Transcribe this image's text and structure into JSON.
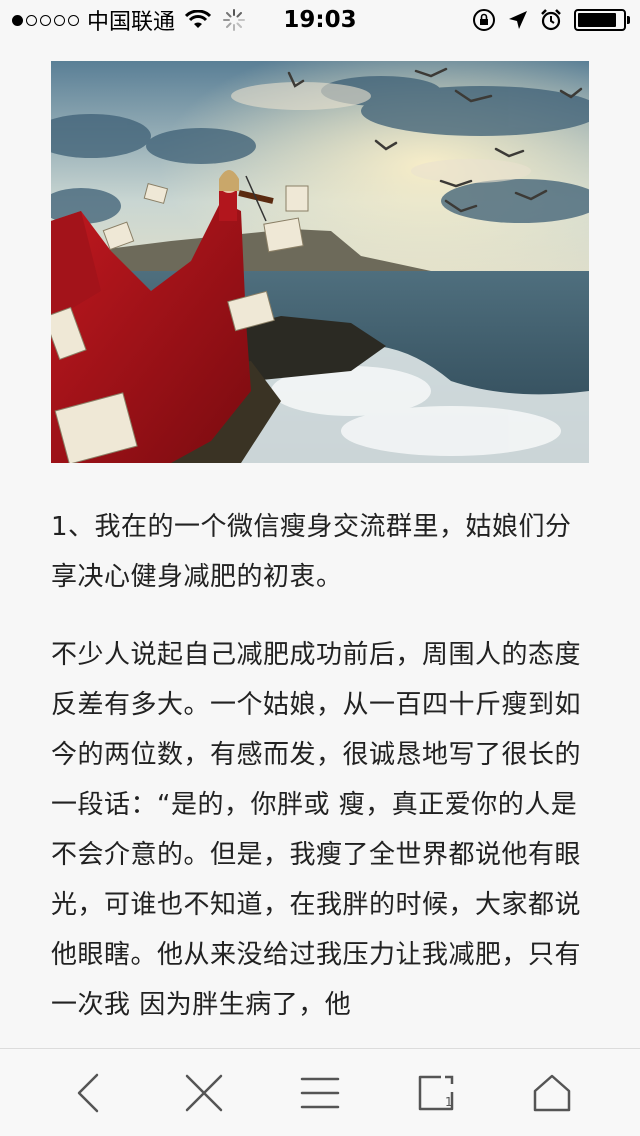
{
  "status_bar": {
    "signal_dots": [
      true,
      false,
      false,
      false,
      false
    ],
    "carrier": "中国联通",
    "time": "19:03",
    "icons": [
      "wifi-icon",
      "loading-spinner-icon",
      "orientation-lock-icon",
      "location-arrow-icon",
      "alarm-icon",
      "battery-icon"
    ],
    "battery_level": 0.85
  },
  "hero_image": {
    "description_icon": "violinist-red-dress-sea-photo"
  },
  "article": {
    "paragraphs": [
      "1、我在的一个微信瘦身交流群里，姑娘们分享决心健身减肥的初衷。",
      "不少人说起自己减肥成功前后，周围人的态度反差有多大。一个姑娘，从一百四十斤瘦到如今的两位数，有感而发，很诚恳地写了很长的一段话：“是的，你胖或 瘦，真正爱你的人是不会介意的。但是，我瘦了全世界都说他有眼光，可谁也不知道，在我胖的时候，大家都说他眼瞎。他从来没给过我压力让我减肥，只有一次我 因为胖生病了，他"
    ]
  },
  "toolbar": {
    "buttons": [
      "back-icon",
      "close-icon",
      "menu-icon",
      "tabs-icon",
      "home-icon"
    ]
  }
}
